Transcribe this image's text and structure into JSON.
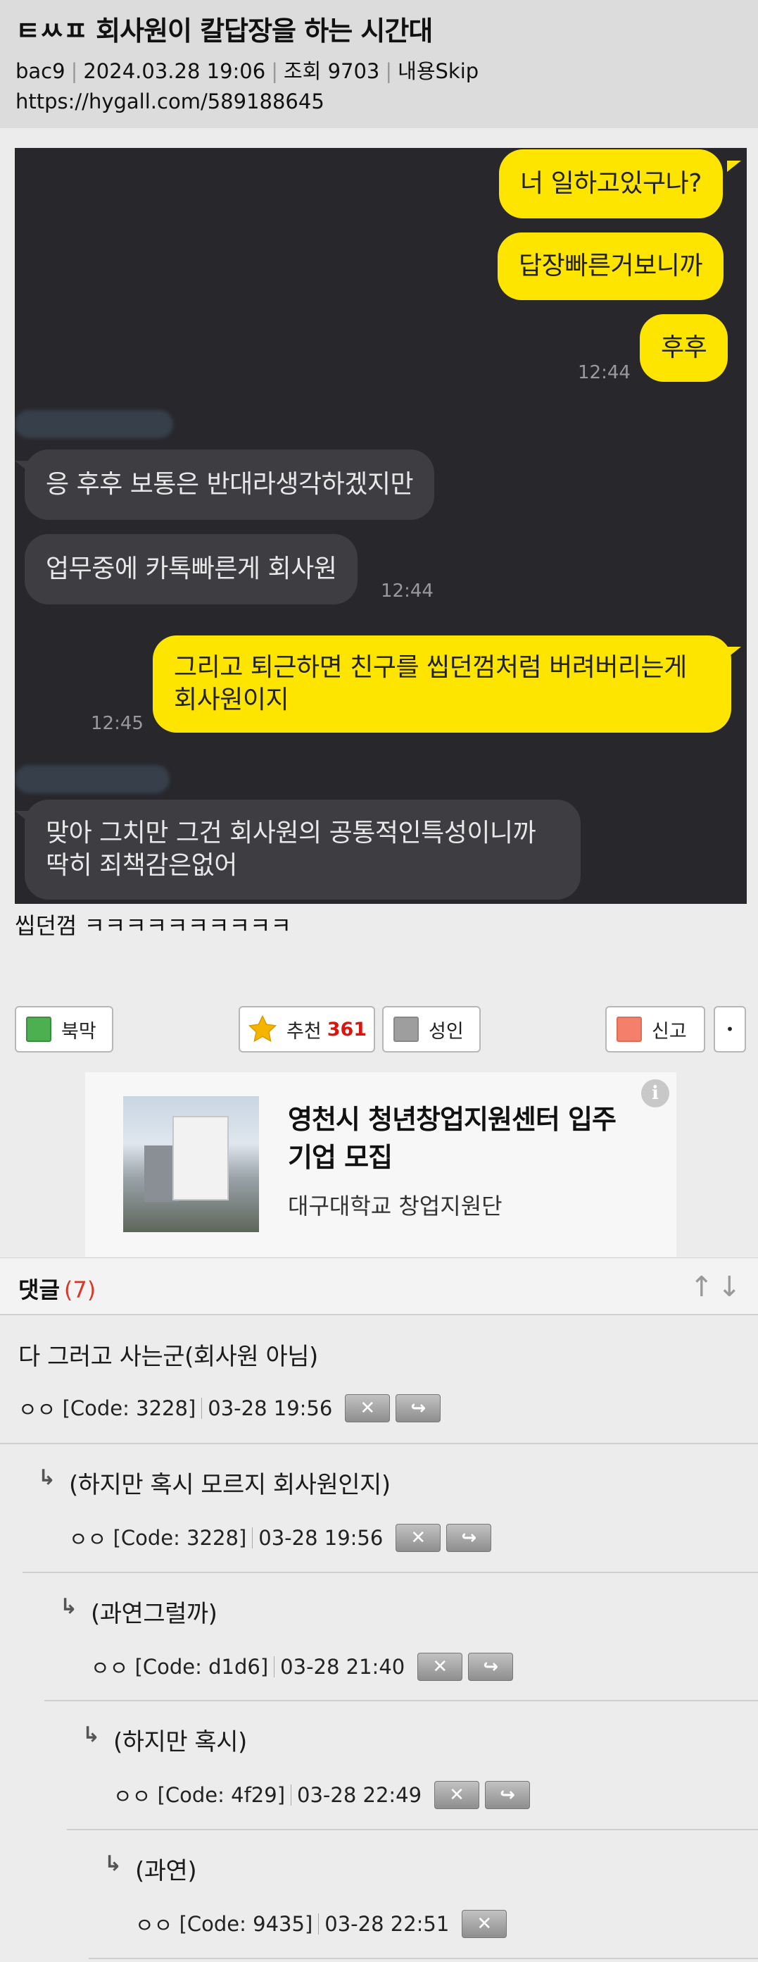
{
  "post": {
    "title": "ㅌㅆㅍ 회사원이 칼답장을 하는 시간대",
    "author": "bac9",
    "datetime": "2024.03.28 19:06",
    "views": "조회 9703",
    "skip": "내용Skip",
    "url": "https://hygall.com/589188645",
    "body_text": "씹던껌 ㅋㅋㅋㅋㅋㅋㅋㅋㅋㅋ"
  },
  "chat": {
    "messages": [
      {
        "side": "me",
        "text": "너 일하고있구나?"
      },
      {
        "side": "me",
        "text": "답장빠른거보니까"
      },
      {
        "side": "me",
        "text": "후후",
        "time": "12:44"
      },
      {
        "side": "other",
        "text": "응 후후 보통은 반대라생각하겠지만"
      },
      {
        "side": "other",
        "text": "업무중에 카톡빠른게 회사원",
        "time": "12:44"
      },
      {
        "side": "me",
        "text": "그리고 퇴근하면 친구를 씹던껌처럼 버려버리는게",
        "text2": "회사원이지",
        "time": "12:45"
      },
      {
        "side": "other",
        "text": "맞아 그치만 그건 회사원의 공통적인특성이니까",
        "text2": "딱히 죄책감은없어"
      }
    ]
  },
  "actions": {
    "bookmark": "북막",
    "recommend": "추천",
    "recommend_count": "361",
    "adult": "성인",
    "report": "신고",
    "more": "•",
    "colors": {
      "bookmark": "#4caf50",
      "adult": "#9e9e9e",
      "report": "#f4806c",
      "star": "#f5b400"
    }
  },
  "ad": {
    "title": "영천시 청년창업지원센터 입주 기업 모집",
    "subtitle": "대구대학교 창업지원단",
    "info_icon": "i"
  },
  "comments": {
    "label": "댓글",
    "count": "(7)",
    "sort_icon": "↑↓",
    "items": [
      {
        "text": "다 그러고 사는군(회사원 아님)",
        "name": "ㅇㅇ",
        "code": "[Code: 3228]",
        "date": "03-28 19:56"
      },
      {
        "text": "(하지만 혹시 모르지 회사원인지)",
        "name": "ㅇㅇ",
        "code": "[Code: 3228]",
        "date": "03-28 19:56"
      },
      {
        "text": "(과연그럴까)",
        "name": "ㅇㅇ",
        "code": "[Code: d1d6]",
        "date": "03-28 21:40"
      },
      {
        "text": "(하지만 혹시)",
        "name": "ㅇㅇ",
        "code": "[Code: 4f29]",
        "date": "03-28 22:49"
      },
      {
        "text": "(과연)",
        "name": "ㅇㅇ",
        "code": "[Code: 9435]",
        "date": "03-28 22:51"
      }
    ],
    "delete_glyph": "✕",
    "reply_glyph": "↪",
    "reply_arrow": "↳"
  }
}
